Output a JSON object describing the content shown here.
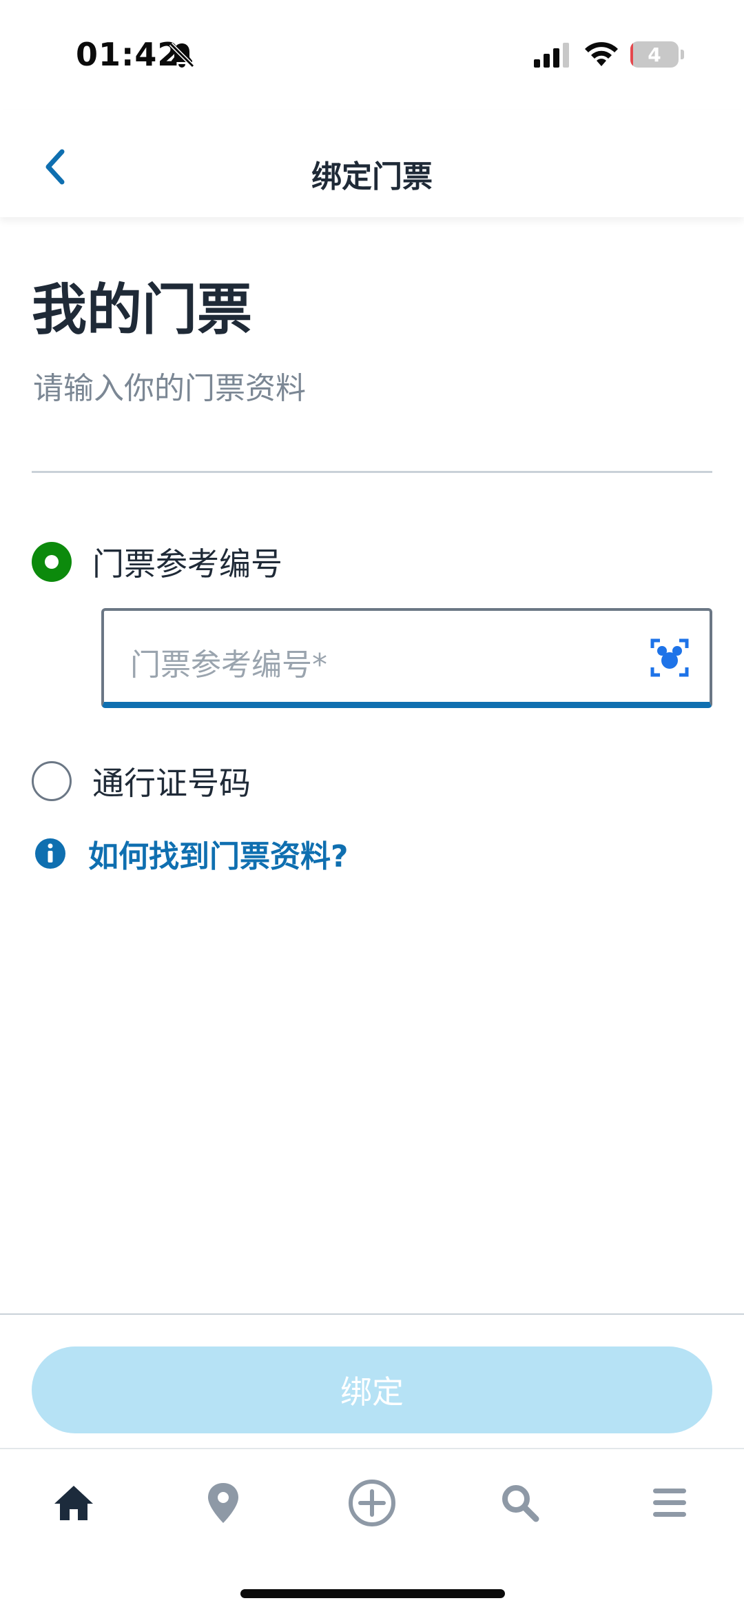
{
  "status_bar": {
    "time": "01:42",
    "battery_level": "4",
    "battery_fraction": 0.04,
    "icons": [
      "bell-muted-icon",
      "cellular-signal-icon",
      "wifi-icon",
      "battery-icon"
    ]
  },
  "nav": {
    "title": "绑定门票",
    "back_icon": "chevron-left-icon"
  },
  "header": {
    "title": "我的门票",
    "subtitle": "请输入你的门票资料"
  },
  "form": {
    "options": [
      {
        "label": "门票参考编号",
        "selected": true
      },
      {
        "label": "通行证号码",
        "selected": false
      }
    ],
    "ticket_ref_placeholder": "门票参考编号*",
    "scan_icon": "mickey-scan-icon",
    "help_link": "如何找到门票资料?",
    "help_icon": "info-icon"
  },
  "action": {
    "bind_label": "绑定"
  },
  "tab_bar": {
    "items": [
      "home-icon",
      "location-pin-icon",
      "add-circle-icon",
      "search-icon",
      "menu-icon"
    ]
  },
  "colors": {
    "accent_blue": "#0f6fb0",
    "selected_green": "#0c8a0c",
    "disabled_button": "#b6e2f5",
    "text_dark": "#1f2a37",
    "text_muted": "#7b8794"
  }
}
